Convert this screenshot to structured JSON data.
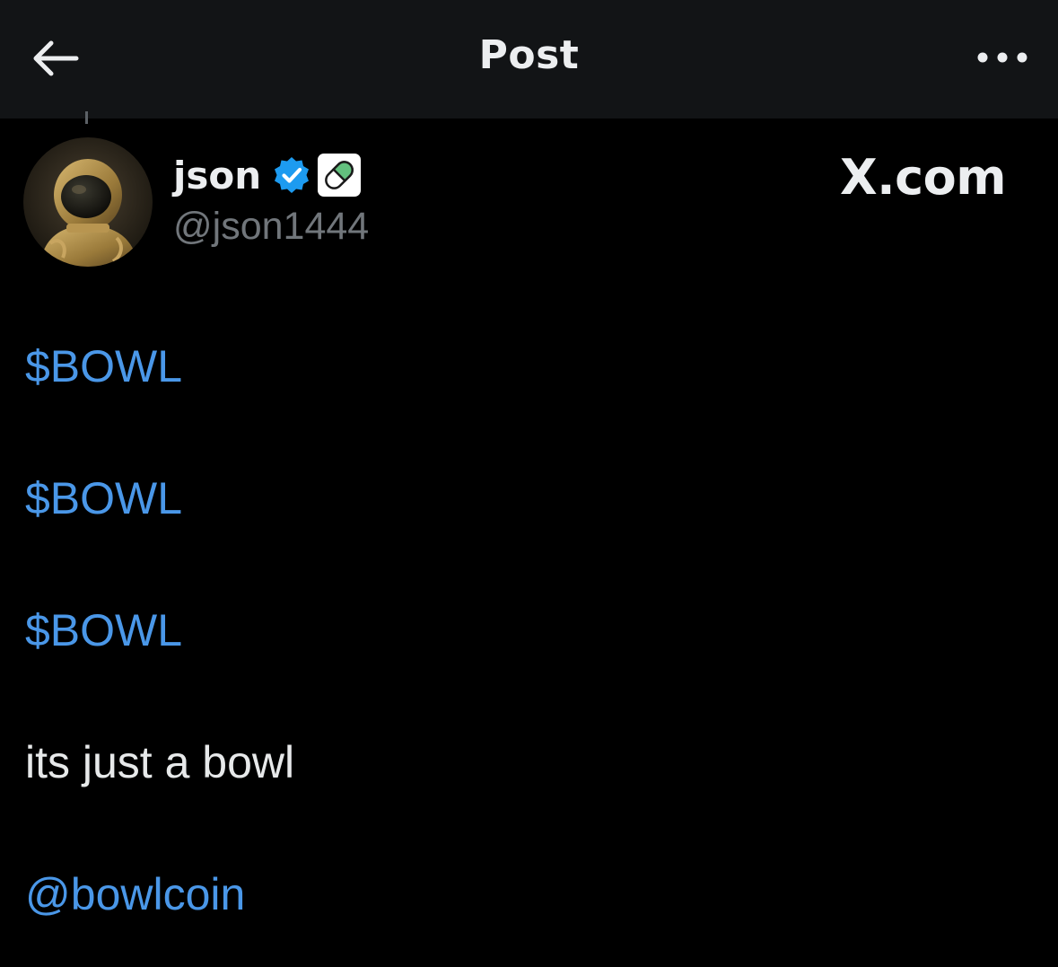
{
  "header": {
    "title": "Post",
    "back_icon": "arrow-left-icon",
    "more_icon": "more-horizontal-icon"
  },
  "author": {
    "display_name": "json",
    "handle": "@json1444",
    "verified_icon": "verified-badge-icon",
    "extra_badge_icon": "pill-emoji-icon",
    "avatar": "astronaut-portrait-avatar"
  },
  "watermark": {
    "label": "X.com"
  },
  "post": {
    "lines": [
      {
        "type": "cashtag",
        "text": "$BOWL"
      },
      {
        "type": "cashtag",
        "text": "$BOWL"
      },
      {
        "type": "cashtag",
        "text": "$BOWL"
      },
      {
        "type": "text",
        "text": "its just a bowl"
      },
      {
        "type": "mention",
        "text": "@bowlcoin"
      }
    ]
  },
  "colors": {
    "background": "#000000",
    "header_background": "#121416",
    "link_blue": "#4a97e8",
    "text_primary": "#e7e9ea",
    "text_secondary": "#71767b",
    "verified_blue": "#1d9bf0"
  }
}
